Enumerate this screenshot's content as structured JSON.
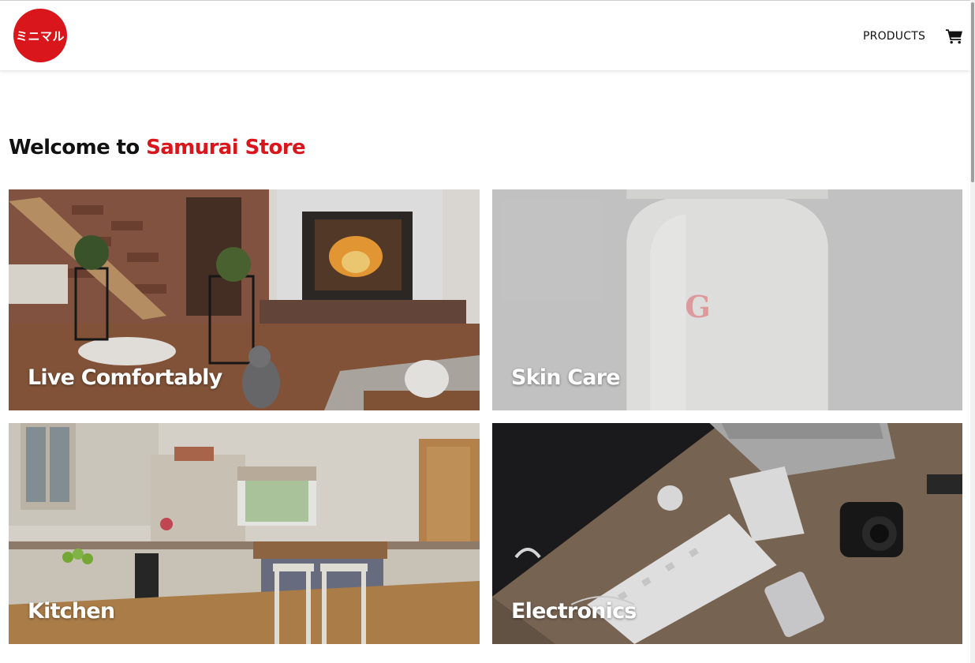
{
  "nav": {
    "logo_text": "ミニマル",
    "products_label": "PRODUCTS",
    "cart_icon": "shopping-cart-icon"
  },
  "heading": {
    "prefix": "Welcome to",
    "brand": "Samurai Store"
  },
  "categories": [
    {
      "label": "Live Comfortably"
    },
    {
      "label": "Skin Care"
    },
    {
      "label": "Kitchen"
    },
    {
      "label": "Electronics"
    }
  ],
  "colors": {
    "brand_red": "#d8161b",
    "text": "#111111",
    "background": "#ffffff"
  }
}
